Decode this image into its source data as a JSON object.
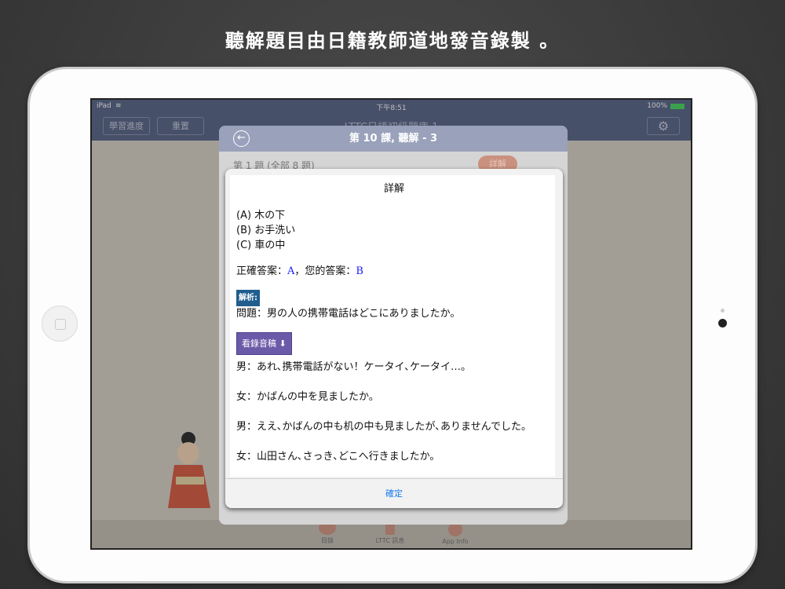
{
  "headline": "聽解題目由日籍教師道地發音錄製 。",
  "status": {
    "device": "iPad",
    "time": "下午8:51",
    "battery": "100%"
  },
  "nav": {
    "progress": "學習進度",
    "reset": "重置",
    "title": "LTTC日語初級題庫 1"
  },
  "panel": {
    "title": "第 10 課, 聽解 - 3",
    "count": "第 1 題 (全部 8 題)",
    "detail": "詳解"
  },
  "alert": {
    "title": "詳解",
    "options": [
      "(A) 木の下",
      "(B) お手洗い",
      "(C) 車の中"
    ],
    "correct_label": "正確答案：",
    "correct": "A",
    "yours_label": "，您的答案：",
    "yours": "B",
    "analysis_tag": "解析:",
    "question": "問題：男の人の携帯電話はどこにありましたか。",
    "transcript_button": "看錄音稿",
    "transcript": [
      "男：あれ､携帯電話がない！ケータイ､ケータイ…。",
      "女：かばんの中を見ましたか。",
      "男：ええ､かばんの中も机の中も見ましたが､ありませんでした。",
      "女：山田さん､さっき､どこへ行きましたか。"
    ],
    "confirm": "確定"
  },
  "tabs": [
    {
      "label": "目錄"
    },
    {
      "label": "LTTC 訊息"
    },
    {
      "label": "App Info"
    }
  ]
}
